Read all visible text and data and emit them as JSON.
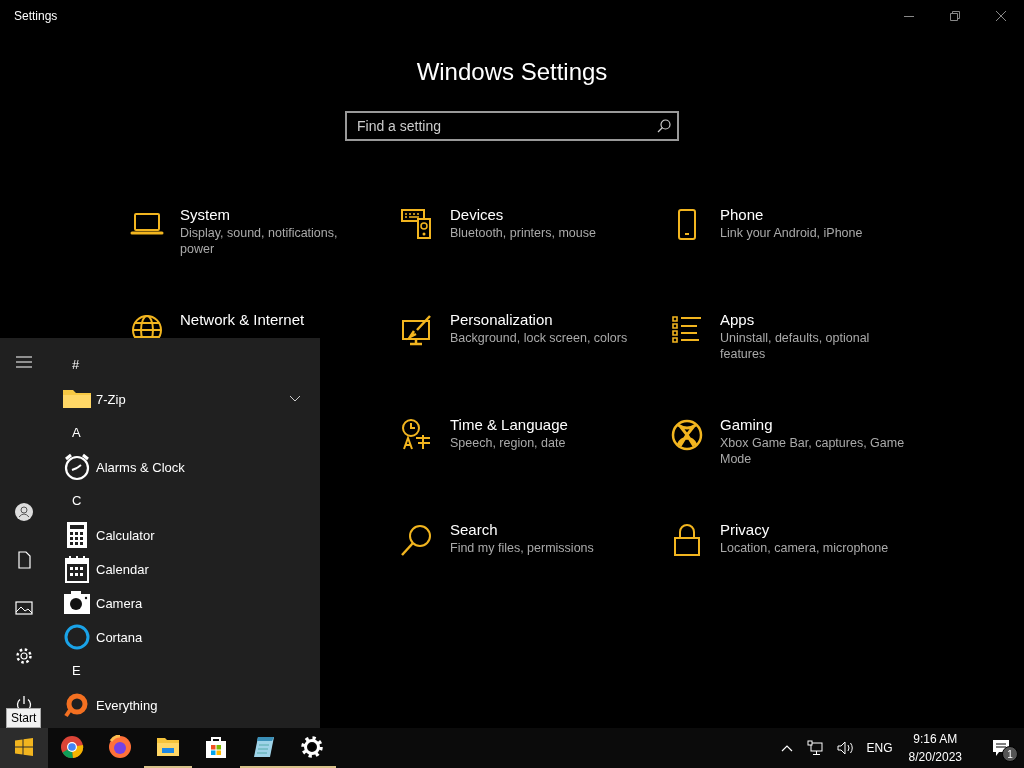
{
  "window": {
    "title": "Settings"
  },
  "settings": {
    "heading": "Windows Settings",
    "search": {
      "placeholder": "Find a setting"
    },
    "rows": [
      [
        {
          "title": "System",
          "description": "Display, sound, notifications, power"
        },
        {
          "title": "Devices",
          "description": "Bluetooth, printers, mouse"
        },
        {
          "title": "Phone",
          "description": "Link your Android, iPhone"
        }
      ],
      [
        {
          "title": "Network & Internet"
        },
        {
          "title": "Personalization",
          "description": "Background, lock screen, colors"
        },
        {
          "title": "Apps",
          "description": "Uninstall, defaults, optional features"
        }
      ],
      [
        {
          "title": "Time & Language",
          "description": "Speech, region, date"
        },
        {
          "title": "Gaming",
          "description": "Xbox Game Bar, captures, Game Mode"
        }
      ],
      [
        {
          "title": "Search",
          "description": "Find my files, permissions"
        },
        {
          "title": "Privacy",
          "description": "Location, camera, microphone"
        }
      ]
    ]
  },
  "start_menu": {
    "items": [
      {
        "kind": "header",
        "label": "#"
      },
      {
        "kind": "folder",
        "label": "7-Zip"
      },
      {
        "kind": "header",
        "label": "A"
      },
      {
        "kind": "app",
        "label": "Alarms & Clock"
      },
      {
        "kind": "header",
        "label": "C"
      },
      {
        "kind": "app",
        "label": "Calculator"
      },
      {
        "kind": "app",
        "label": "Calendar"
      },
      {
        "kind": "app",
        "label": "Camera"
      },
      {
        "kind": "app",
        "label": "Cortana"
      },
      {
        "kind": "header",
        "label": "E"
      },
      {
        "kind": "app",
        "label": "Everything"
      }
    ],
    "tooltip": "Start"
  },
  "taskbar": {
    "start_hovered": true,
    "pinned": [
      {
        "running": false
      },
      {
        "running": false
      },
      {
        "running": true
      },
      {
        "running": false
      },
      {
        "running": true
      },
      {
        "running": true
      }
    ],
    "tray": {
      "language": "ENG",
      "time": "9:16 AM",
      "date": "8/20/2023",
      "notifications": "1"
    }
  }
}
